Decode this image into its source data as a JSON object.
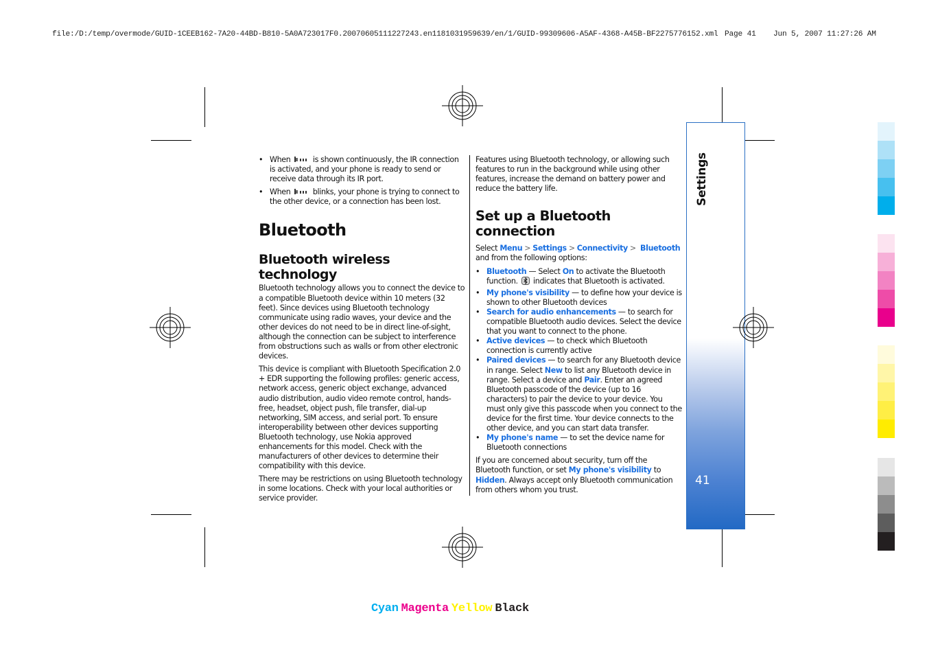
{
  "print_header": {
    "file_path": "file:/D:/temp/overmode/GUID-1CEEB162-7A20-44BD-B810-5A0A723017F0.20070605111227243.en1181031959639/en/1/GUID-99309606-A5AF-4368-A45B-BF2275776152.xml",
    "page_label": "Page 41",
    "timestamp": "Jun 5, 2007 11:27:26 AM"
  },
  "left_column": {
    "ir_bullets": [
      {
        "pre": "When",
        "icon": "ir-port-icon",
        "post": "is shown continuously, the IR connection is activated, and your phone is ready to send or receive data through its IR port."
      },
      {
        "pre": "When",
        "icon": "ir-port-icon",
        "post": "blinks, your phone is trying to connect to the other device, or a connection has been lost."
      }
    ],
    "section_title": "Bluetooth",
    "subsection_title": "Bluetooth wireless technology",
    "paragraphs": [
      "Bluetooth technology allows you to connect the device to a compatible Bluetooth device within 10 meters (32 feet). Since devices using Bluetooth technology communicate using radio waves, your device and the other devices do not need to be in direct line-of-sight, although the connection can be subject to interference from obstructions such as walls or from other electronic devices.",
      "This device is compliant with Bluetooth Specification 2.0 + EDR supporting the following profiles: generic access, network access, generic object exchange, advanced audio distribution, audio video remote control, hands-free, headset, object push, file transfer, dial-up networking, SIM access, and serial port. To ensure interoperability between other devices supporting Bluetooth technology, use Nokia approved enhancements for this model. Check with the manufacturers of other devices to determine their compatibility with this device.",
      "There may be restrictions on using Bluetooth technology in some locations. Check with your local authorities or service provider."
    ]
  },
  "right_column": {
    "intro": "Features using Bluetooth technology, or allowing such features to run in the background while using other features, increase the demand on battery power and reduce the battery life.",
    "subsection_title": "Set up a Bluetooth connection",
    "nav_path": {
      "pre": "Select",
      "steps": [
        "Menu",
        "Settings",
        "Connectivity",
        "Bluetooth"
      ],
      "separator": ">",
      "post": "and from the following options:"
    },
    "options": [
      {
        "label": "Bluetooth",
        "text_a": " —  Select ",
        "kw2": "On",
        "text_b": " to activate the Bluetooth function. ",
        "icon": "bluetooth-icon",
        "text_c": " indicates that Bluetooth is activated."
      },
      {
        "label": "My phone's visibility",
        "text_a": " — to define how your device is shown to other Bluetooth devices"
      },
      {
        "label": "Search for audio enhancements",
        "text_a": " — to search for compatible Bluetooth audio devices. Select the device that you want to connect to the phone."
      },
      {
        "label": "Active devices",
        "text_a": " — to check which Bluetooth connection is currently active"
      },
      {
        "label": "Paired devices",
        "text_a": " — to search for any Bluetooth device in range. Select ",
        "kw2": "New",
        "text_b": " to list any Bluetooth device in range. Select a device and ",
        "kw3": "Pair",
        "text_c": ". Enter an agreed Bluetooth passcode of the device (up to 16 characters) to pair the device to your device. You must only give this passcode when you connect to the device for the first time. Your device connects to the other device, and you can start data transfer."
      },
      {
        "label": "My phone's name",
        "text_a": " — to set the device name for Bluetooth connections"
      }
    ],
    "security_note": {
      "pre": "If you are concerned about security, turn off the Bluetooth function, or set ",
      "kw1": "My phone's visibility",
      "mid": " to ",
      "kw2": "Hidden",
      "post": ". Always accept only Bluetooth communication from others whom you trust."
    }
  },
  "side_tab": {
    "title": "Settings",
    "page_number": "41"
  },
  "color_bar": {
    "cyan": [
      "#e3f4fc",
      "#aee1f7",
      "#7dd0f3",
      "#47c0ef",
      "#00aeeb"
    ],
    "magenta": [
      "#fce3f0",
      "#f7b0d8",
      "#f283c3",
      "#ee4ca8",
      "#e9008c"
    ],
    "yellow": [
      "#fffbdc",
      "#fff6a8",
      "#fff276",
      "#ffee45",
      "#ffec00"
    ],
    "black": [
      "#e6e6e6",
      "#bbbbbb",
      "#8d8d8d",
      "#5d5d5d",
      "#231f20"
    ]
  },
  "cmyk_labels": [
    {
      "text": "Cyan",
      "color": "#00aeef"
    },
    {
      "text": "Magenta",
      "color": "#ec008c"
    },
    {
      "text": "Yellow",
      "color": "#fff200"
    },
    {
      "text": "Black",
      "color": "#231f20"
    }
  ],
  "accent_color": "#1a6fe0"
}
